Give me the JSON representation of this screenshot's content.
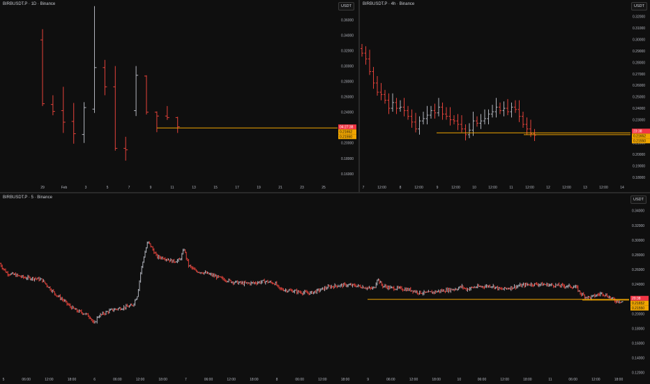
{
  "colors": {
    "up": "#b2b5be",
    "down": "#e5423a",
    "bg": "#0f0f0f",
    "axis_text": "#b2b5be",
    "level": "#f0a500",
    "price_tag": "#f23645",
    "level_tag": "#f0a500"
  },
  "panes": [
    {
      "title": "BIRBUSDT.P · 1D · Binance",
      "currency": "USDT"
    },
    {
      "title": "BIRBUSDT.P · 4h · Binance",
      "currency": "USDT"
    },
    {
      "title": "BIRBUSDT.P · 5 · Binance",
      "currency": "USDT"
    }
  ],
  "chart_data": [
    {
      "type": "candlestick",
      "timeframe": "1D",
      "y_ticks": [
        "0.36000",
        "0.34000",
        "0.32000",
        "0.30000",
        "0.28000",
        "0.26000",
        "0.24000",
        "0.22000",
        "0.20000",
        "0.18000",
        "0.16000"
      ],
      "ylim": [
        0.148,
        0.375
      ],
      "x_ticks": [
        "29",
        "Feb",
        "3",
        "5",
        "7",
        "9",
        "11",
        "13",
        "15",
        "17",
        "19",
        "21",
        "23",
        "25"
      ],
      "candles": [
        {
          "o": 0.334,
          "h": 0.348,
          "l": 0.248,
          "c": 0.251
        },
        {
          "o": 0.25,
          "h": 0.262,
          "l": 0.236,
          "c": 0.241
        },
        {
          "o": 0.242,
          "h": 0.273,
          "l": 0.213,
          "c": 0.227
        },
        {
          "o": 0.228,
          "h": 0.252,
          "l": 0.199,
          "c": 0.212
        },
        {
          "o": 0.211,
          "h": 0.253,
          "l": 0.2,
          "c": 0.246
        },
        {
          "o": 0.244,
          "h": 0.378,
          "l": 0.239,
          "c": 0.298
        },
        {
          "o": 0.298,
          "h": 0.308,
          "l": 0.262,
          "c": 0.273
        },
        {
          "o": 0.273,
          "h": 0.3,
          "l": 0.19,
          "c": 0.193
        },
        {
          "o": 0.193,
          "h": 0.208,
          "l": 0.177,
          "c": 0.191
        },
        {
          "o": 0.242,
          "h": 0.3,
          "l": 0.235,
          "c": 0.288
        },
        {
          "o": 0.287,
          "h": 0.288,
          "l": 0.237,
          "c": 0.24
        },
        {
          "o": 0.24,
          "h": 0.241,
          "l": 0.214,
          "c": 0.235
        },
        {
          "o": 0.235,
          "h": 0.248,
          "l": 0.23,
          "c": 0.233
        },
        {
          "o": 0.233,
          "h": 0.234,
          "l": 0.213,
          "c": 0.221
        }
      ],
      "level": 0.2195,
      "price_tags": [
        "04:27:38",
        "0.21652",
        "0.21550"
      ]
    },
    {
      "type": "candlestick",
      "timeframe": "4h",
      "y_ticks": [
        "0.32000",
        "0.31000",
        "0.30000",
        "0.29000",
        "0.28000",
        "0.27000",
        "0.26000",
        "0.25000",
        "0.24000",
        "0.23000",
        "0.22000",
        "0.21000",
        "0.20000",
        "0.19000",
        "0.18000"
      ],
      "ylim": [
        0.175,
        0.327
      ],
      "x_ticks": [
        "7",
        "12:00",
        "8",
        "12:00",
        "9",
        "12:00",
        "10",
        "12:00",
        "11",
        "12:00",
        "12",
        "12:00",
        "13",
        "12:00",
        "14"
      ],
      "closes": [
        0.288,
        0.283,
        0.272,
        0.262,
        0.254,
        0.252,
        0.247,
        0.24,
        0.245,
        0.24,
        0.241,
        0.238,
        0.233,
        0.228,
        0.222,
        0.229,
        0.231,
        0.234,
        0.238,
        0.236,
        0.241,
        0.235,
        0.233,
        0.23,
        0.229,
        0.226,
        0.222,
        0.217,
        0.221,
        0.229,
        0.227,
        0.229,
        0.231,
        0.235,
        0.237,
        0.241,
        0.238,
        0.24,
        0.237,
        0.241,
        0.239,
        0.233,
        0.226,
        0.222,
        0.218,
        0.2165
      ],
      "level_lines": [
        0.2186,
        0.217
      ],
      "price_tags": [
        "23:38",
        "0.21652",
        "0.21550"
      ]
    },
    {
      "type": "candlestick",
      "timeframe": "5",
      "y_ticks": [
        "0.34000",
        "0.32000",
        "0.30000",
        "0.28000",
        "0.26000",
        "0.24000",
        "0.22000",
        "0.20000",
        "0.18000",
        "0.16000",
        "0.14000",
        "0.12000"
      ],
      "ylim": [
        0.115,
        0.352
      ],
      "x_ticks": [
        "5",
        "06:00",
        "12:00",
        "18:00",
        "6",
        "06:00",
        "12:00",
        "18:00",
        "7",
        "06:00",
        "12:00",
        "18:00",
        "8",
        "06:00",
        "12:00",
        "18:00",
        "9",
        "06:00",
        "12:00",
        "18:00",
        "10",
        "06:00",
        "12:00",
        "18:00",
        "11",
        "06:00",
        "12:00",
        "18:00"
      ],
      "close_path": [
        [
          0,
          0.268
        ],
        [
          4,
          0.262
        ],
        [
          10,
          0.255
        ],
        [
          20,
          0.253
        ],
        [
          35,
          0.249
        ],
        [
          50,
          0.248
        ],
        [
          60,
          0.246
        ],
        [
          70,
          0.236
        ],
        [
          80,
          0.226
        ],
        [
          90,
          0.219
        ],
        [
          100,
          0.21
        ],
        [
          110,
          0.204
        ],
        [
          122,
          0.2
        ],
        [
          130,
          0.195
        ],
        [
          135,
          0.185
        ],
        [
          140,
          0.196
        ],
        [
          150,
          0.201
        ],
        [
          160,
          0.205
        ],
        [
          170,
          0.207
        ],
        [
          180,
          0.209
        ],
        [
          190,
          0.211
        ],
        [
          197,
          0.225
        ],
        [
          202,
          0.258
        ],
        [
          207,
          0.28
        ],
        [
          212,
          0.298
        ],
        [
          218,
          0.289
        ],
        [
          225,
          0.277
        ],
        [
          235,
          0.276
        ],
        [
          248,
          0.271
        ],
        [
          258,
          0.273
        ],
        [
          264,
          0.288
        ],
        [
          270,
          0.266
        ],
        [
          280,
          0.258
        ],
        [
          292,
          0.256
        ],
        [
          305,
          0.252
        ],
        [
          320,
          0.247
        ],
        [
          335,
          0.243
        ],
        [
          350,
          0.241
        ],
        [
          365,
          0.242
        ],
        [
          380,
          0.244
        ],
        [
          395,
          0.241
        ],
        [
          400,
          0.234
        ],
        [
          410,
          0.232
        ],
        [
          420,
          0.231
        ],
        [
          432,
          0.229
        ],
        [
          445,
          0.228
        ],
        [
          458,
          0.232
        ],
        [
          470,
          0.236
        ],
        [
          482,
          0.238
        ],
        [
          496,
          0.239
        ],
        [
          510,
          0.238
        ],
        [
          523,
          0.236
        ],
        [
          530,
          0.234
        ],
        [
          537,
          0.235
        ],
        [
          541,
          0.248
        ],
        [
          548,
          0.238
        ],
        [
          560,
          0.235
        ],
        [
          575,
          0.234
        ],
        [
          590,
          0.232
        ],
        [
          600,
          0.229
        ],
        [
          612,
          0.228
        ],
        [
          625,
          0.23
        ],
        [
          640,
          0.232
        ],
        [
          655,
          0.234
        ],
        [
          662,
          0.237
        ],
        [
          668,
          0.233
        ],
        [
          680,
          0.236
        ],
        [
          692,
          0.237
        ],
        [
          705,
          0.238
        ],
        [
          718,
          0.233
        ],
        [
          730,
          0.235
        ],
        [
          745,
          0.238
        ],
        [
          760,
          0.24
        ],
        [
          775,
          0.24
        ],
        [
          790,
          0.239
        ],
        [
          805,
          0.238
        ],
        [
          818,
          0.237
        ],
        [
          826,
          0.236
        ],
        [
          832,
          0.228
        ],
        [
          840,
          0.223
        ],
        [
          846,
          0.222
        ],
        [
          855,
          0.225
        ],
        [
          863,
          0.228
        ],
        [
          873,
          0.223
        ],
        [
          882,
          0.2175
        ],
        [
          893,
          0.2165
        ]
      ],
      "level_lines": [
        0.2195,
        0.2185
      ],
      "price_tags": [
        "20:38",
        "0.21652",
        "0.21550"
      ]
    }
  ]
}
